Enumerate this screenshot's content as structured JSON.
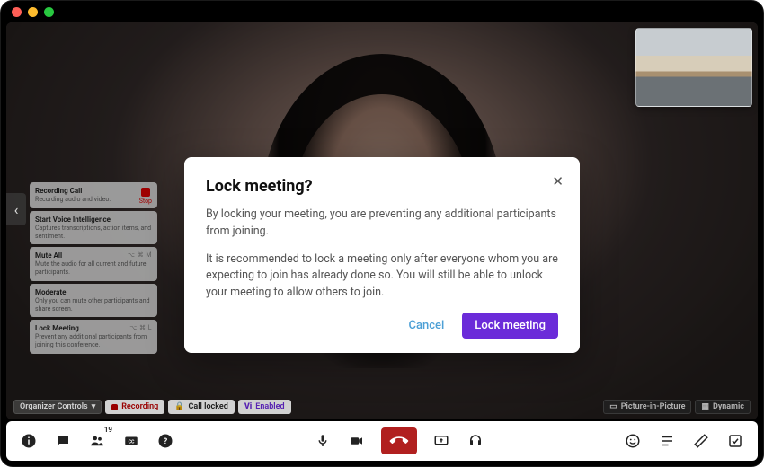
{
  "window": {
    "traffic": [
      "close",
      "minimize",
      "zoom"
    ]
  },
  "pip": {
    "label": "Remote room thumbnail"
  },
  "controls_panel": {
    "expand_tooltip": "Collapse",
    "items": [
      {
        "title": "Recording Call",
        "subtitle": "Recording audio and video.",
        "action": "Stop"
      },
      {
        "title": "Start Voice Intelligence",
        "subtitle": "Captures transcriptions, action items, and sentiment."
      },
      {
        "title": "Mute All",
        "subtitle": "Mute the audio for all current and future participants.",
        "shortcut": "⌥ ⌘ M"
      },
      {
        "title": "Moderate",
        "subtitle": "Only you can mute other participants and share screen."
      },
      {
        "title": "Lock Meeting",
        "subtitle": "Prevent any additional participants from joining this conference.",
        "shortcut": "⌥ ⌘ L"
      }
    ]
  },
  "status_badges": {
    "organizer": "Organizer Controls",
    "recording": "Recording",
    "locked": "Call locked",
    "vi": "Enabled",
    "vi_prefix": "Vi",
    "pip_mode": "Picture-in-Picture",
    "layout": "Dynamic"
  },
  "modal": {
    "title": "Lock meeting?",
    "body1": "By locking your meeting, you are preventing any additional participants from joining.",
    "body2": "It is recommended to lock a meeting only after everyone whom you are expecting to join has already done so. You will still be able to unlock your meeting to allow others to join.",
    "cancel": "Cancel",
    "confirm": "Lock meeting"
  },
  "toolbar": {
    "participants_count": "19",
    "icons": {
      "info": "info",
      "chat": "chat",
      "participants": "participants",
      "cc": "cc",
      "help": "help",
      "mic": "mic",
      "camera": "camera",
      "end": "end-call",
      "share": "share-screen",
      "headset": "headset",
      "reactions": "reactions",
      "notes": "notes",
      "whiteboard": "whiteboard",
      "tasks": "tasks"
    }
  }
}
